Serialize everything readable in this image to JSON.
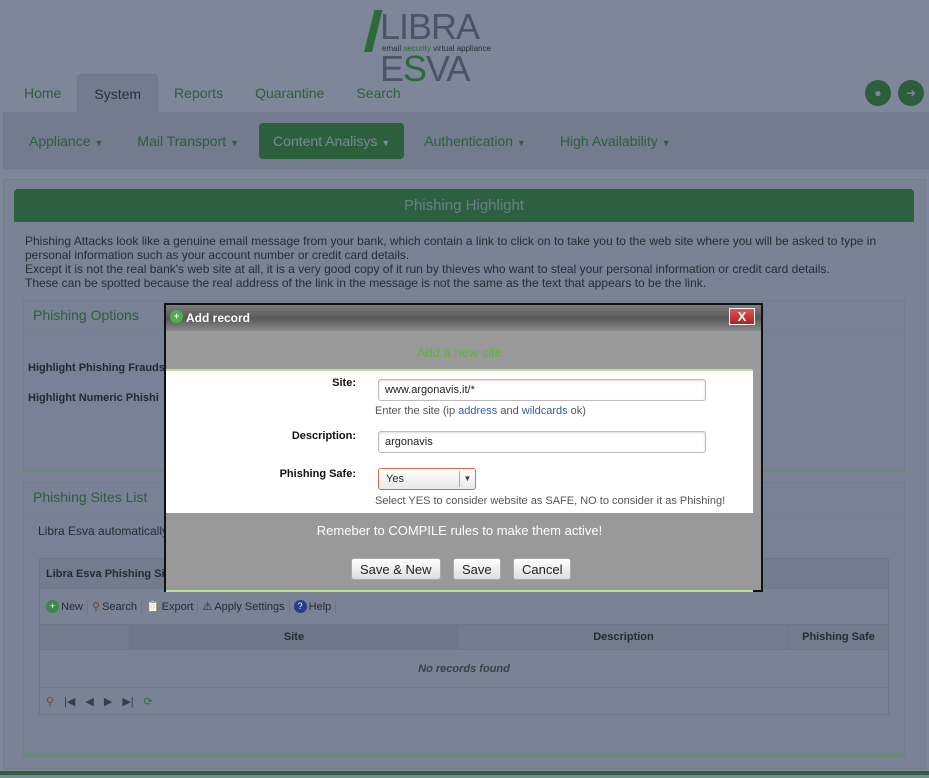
{
  "logo": {
    "main": "LIBRA E",
    "accent": "S",
    "tail": "VA",
    "tag_pre": "email ",
    "tag_accent": "security",
    "tag_post": " virtual appliance"
  },
  "tabs": [
    {
      "label": "Home"
    },
    {
      "label": "System",
      "active": true
    },
    {
      "label": "Reports"
    },
    {
      "label": "Quarantine"
    },
    {
      "label": "Search"
    }
  ],
  "subnav": [
    {
      "label": "Appliance"
    },
    {
      "label": "Mail Transport"
    },
    {
      "label": "Content Analisys",
      "active": true
    },
    {
      "label": "Authentication"
    },
    {
      "label": "High Availability"
    }
  ],
  "page": {
    "title": "Phishing Highlight",
    "intro": [
      "Phishing Attacks look like a genuine email message from your bank, which contain a link to click on to take you to the web site where you will be asked to type in personal information such as your account number or credit card details.",
      "Except it is not the real bank's web site at all, it is a very good copy of it run by thieves who want to steal your personal information or credit card details.",
      "These can be spotted because the real address of the link in the message is not the same as the text that appears to be the link."
    ]
  },
  "options": {
    "title": "Phishing Options",
    "labels": [
      "Highlight Phishing Frauds",
      "Highlight Numeric Phishi"
    ]
  },
  "sites": {
    "title": "Phishing Sites List",
    "desc": "Libra Esva automatically",
    "grid": {
      "caption": "Libra Esva Phishing Si",
      "toolbar": [
        "New",
        "Search",
        "Export",
        "Apply Settings",
        "Help"
      ],
      "columns": [
        "",
        "Site",
        "Description",
        "Phishing Safe"
      ],
      "empty": "No records found"
    }
  },
  "dialog": {
    "title": "Add record",
    "close": "X",
    "subtitle": "Add a new site",
    "site_label": "Site:",
    "site_value": "www.argonavis.it/*",
    "site_hint_pre": "Enter the site (ip ",
    "site_hint_link": "address",
    "site_hint_mid": " and ",
    "site_hint_link2": "wildcards",
    "site_hint_post": " ok)",
    "desc_label": "Description:",
    "desc_value": "argonavis",
    "safe_label": "Phishing Safe:",
    "safe_value": "Yes",
    "safe_hint": "Select YES to consider website as SAFE, NO to consider it as Phishing!",
    "reminder": "Remeber to COMPILE rules to make them active!",
    "buttons": {
      "save_new": "Save & New",
      "save": "Save",
      "cancel": "Cancel"
    }
  },
  "colors": {
    "brand_green": "#2c5f3c",
    "accent_green": "#5fb241",
    "close_red": "#c33"
  }
}
